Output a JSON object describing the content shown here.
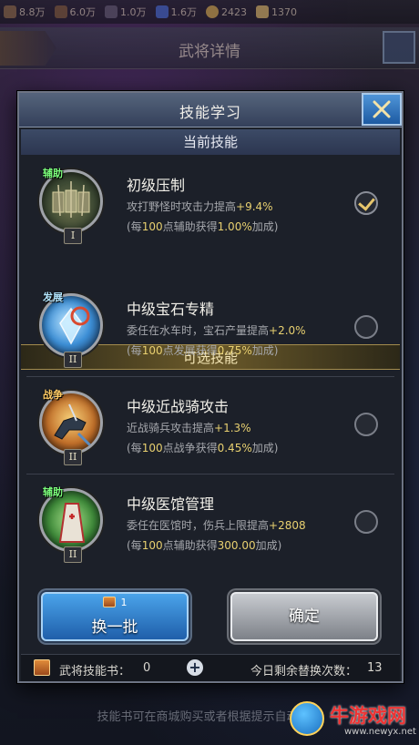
{
  "background": {
    "resources": [
      {
        "value": "8.8万",
        "icon": "military-icon",
        "color": "#8a6a3a"
      },
      {
        "value": "6.0万",
        "icon": "wood-icon",
        "color": "#7a5a2a"
      },
      {
        "value": "1.0万",
        "icon": "iron-icon",
        "color": "#5a5a66"
      },
      {
        "value": "1.6万",
        "icon": "gem-icon",
        "color": "#3a6acc"
      },
      {
        "value": "2423",
        "icon": "coin-icon",
        "color": "#d8b040"
      },
      {
        "value": "1370",
        "icon": "ingot-icon",
        "color": "#e0c060"
      }
    ],
    "page_title": "武将详情",
    "hint": "技能书可在商城购买或者根据提示自动购买"
  },
  "dialog": {
    "title": "技能学习",
    "current_section": "当前技能",
    "optional_section": "可选技能",
    "current_skill": {
      "tag": "辅助",
      "tag_icon": "assist-tag-icon",
      "level": "I",
      "name": "初级压制",
      "desc_prefix": "攻打野怪时攻击力提高",
      "desc_value": "+9.4%",
      "bonus_prefix": "(每",
      "bonus_points": "100",
      "bonus_mid": "点辅助获得",
      "bonus_value": "1.00%",
      "bonus_suffix": "加成)",
      "selected": true
    },
    "options": [
      {
        "tag": "发展",
        "tag_icon": "develop-tag-icon",
        "level": "II",
        "name": "中级宝石专精",
        "desc_prefix": "委任在水车时，宝石产量提高",
        "desc_value": "+2.0%",
        "bonus_prefix": "(每",
        "bonus_points": "100",
        "bonus_mid": "点发展获得",
        "bonus_value": "0.75%",
        "bonus_suffix": "加成)",
        "selected": false
      },
      {
        "tag": "战争",
        "tag_icon": "war-tag-icon",
        "level": "II",
        "name": "中级近战骑攻击",
        "desc_prefix": "近战骑兵攻击提高",
        "desc_value": "+1.3%",
        "bonus_prefix": "(每",
        "bonus_points": "100",
        "bonus_mid": "点战争获得",
        "bonus_value": "0.45%",
        "bonus_suffix": "加成)",
        "selected": false
      },
      {
        "tag": "辅助",
        "tag_icon": "assist-tag-icon",
        "level": "II",
        "name": "中级医馆管理",
        "desc_prefix": "委任在医馆时，伤兵上限提高",
        "desc_value": "+2808",
        "bonus_prefix": "(每",
        "bonus_points": "100",
        "bonus_mid": "点辅助获得",
        "bonus_value": "300.00",
        "bonus_suffix": "加成)",
        "selected": false
      }
    ],
    "swap_button": {
      "cost": "1",
      "label": "换一批"
    },
    "confirm_button": {
      "label": "确定"
    },
    "footer": {
      "book_label": "武将技能书：",
      "book_count": "0",
      "remain_label": "今日剩余替换次数：",
      "remain_count": "13"
    }
  },
  "watermark": {
    "text": "牛游戏网",
    "url": "www.newyx.net"
  }
}
